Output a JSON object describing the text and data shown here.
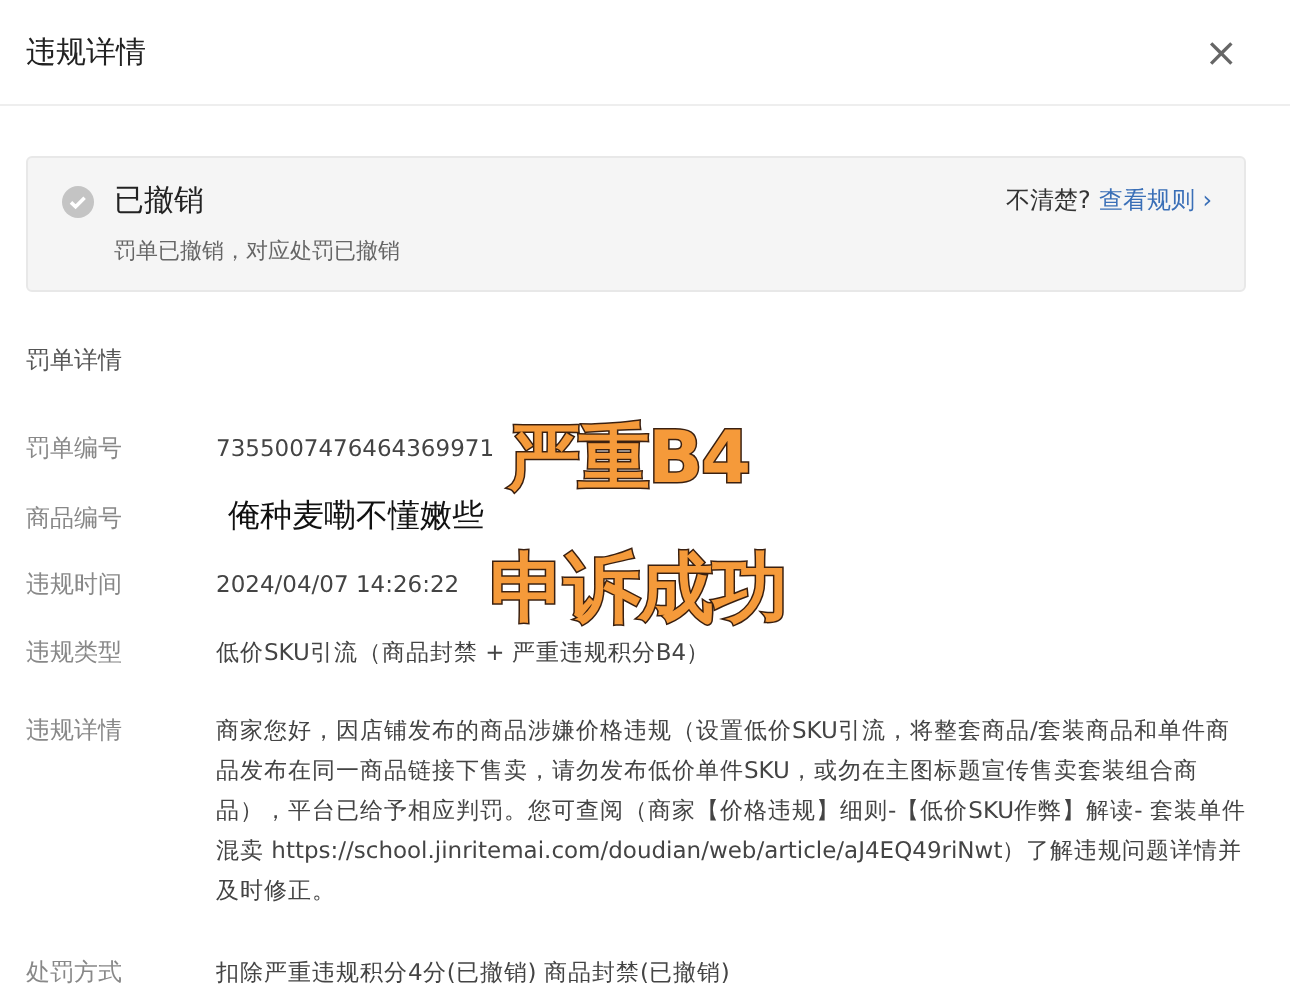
{
  "dialog": {
    "title": "违规详情",
    "close": "×"
  },
  "status": {
    "title": "已撤销",
    "description": "罚单已撤销，对应处罚已撤销",
    "help_text": "不清楚?",
    "help_link": "查看规则",
    "link_arrow": "›"
  },
  "section_title": "罚单详情",
  "rows": [
    {
      "label": "罚单编号",
      "value": "7355007476464369971",
      "kind": "plain"
    },
    {
      "label": "商品编号",
      "value": "俺种麦嘞不懂嫩些",
      "kind": "large"
    },
    {
      "label": "违规时间",
      "value": "2024/04/07 14:26:22",
      "kind": "plain"
    },
    {
      "label": "违规类型",
      "value": "低价SKU引流（商品封禁 + 严重违规积分B4）",
      "kind": "plain"
    },
    {
      "label": "违规详情",
      "value": "商家您好，因店铺发布的商品涉嫌价格违规（设置低价SKU引流，将整套商品/套装商品和单件商品发布在同一商品链接下售卖，请勿发布低价单件SKU，或勿在主图标题宣传售卖套装组合商品），平台已给予相应判罚。您可查阅（商家【价格违规】细则-【低价SKU作弊】解读- 套装单件混卖 https://school.jinritemai.com/doudian/web/article/aJ4EQ49riNwt）了解违规问题详情并及时修正。",
      "kind": "plain"
    },
    {
      "label": "处罚方式",
      "value": "扣除严重违规积分4分(已撤销) 商品封禁(已撤销)",
      "kind": "plain"
    }
  ],
  "stickers": [
    "严重B4",
    "申诉成功"
  ]
}
